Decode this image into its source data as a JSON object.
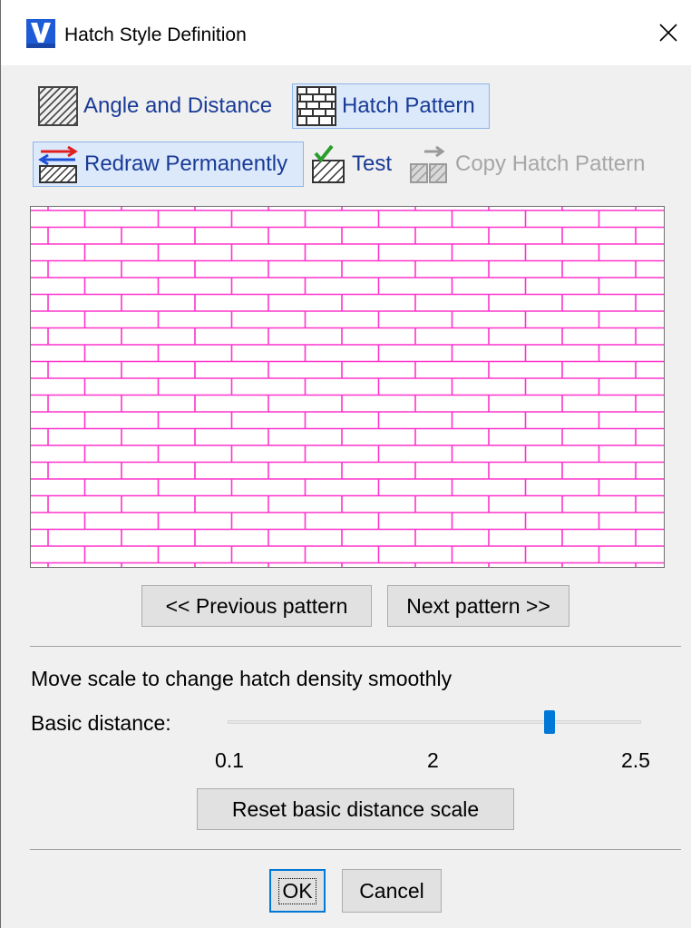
{
  "window": {
    "title": "Hatch Style Definition",
    "app_icon": "vectorcad-logo-icon"
  },
  "toolbar": {
    "angle_distance_label": "Angle and Distance",
    "hatch_pattern_label": "Hatch Pattern",
    "redraw_label": "Redraw Permanently",
    "test_label": "Test",
    "copy_label": "Copy Hatch Pattern",
    "selected": [
      "hatch_pattern",
      "redraw_permanently"
    ],
    "disabled": [
      "copy_hatch_pattern"
    ]
  },
  "preview": {
    "pattern": "brick",
    "line_color": "#ff33cc",
    "background": "#ffffff"
  },
  "nav": {
    "prev_label": "<< Previous pattern",
    "next_label": "Next pattern >>"
  },
  "scale": {
    "description": "Move scale to change hatch density smoothly",
    "basic_distance_label": "Basic distance:",
    "min_label": "0.1",
    "mid_label": "2",
    "max_label": "2.5",
    "reset_label": "Reset basic distance scale"
  },
  "footer": {
    "ok_label": "OK",
    "cancel_label": "Cancel"
  },
  "colors": {
    "accent": "#0078d7",
    "link_text": "#1a3b96",
    "pattern_line": "#ff33cc"
  }
}
